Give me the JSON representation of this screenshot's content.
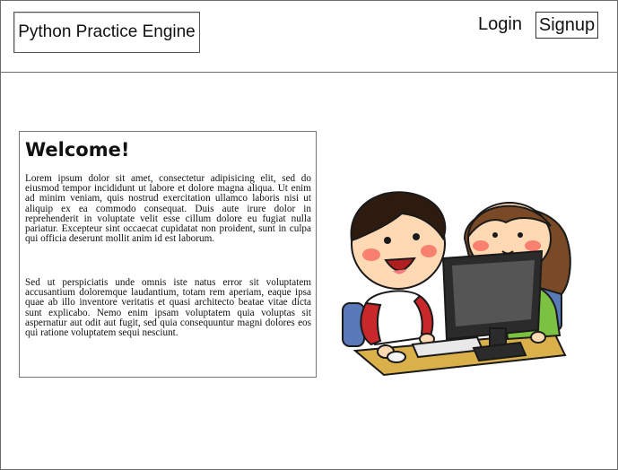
{
  "header": {
    "brand": "Python Practice Engine",
    "login_label": "Login",
    "signup_label": "Signup"
  },
  "welcome": {
    "title": "Welcome!",
    "paragraph_1": "Lorem ipsum dolor sit amet, consectetur adipisicing elit, sed do eiusmod tempor incididunt ut labore et dolore magna aliqua. Ut enim ad minim veniam, quis nostrud exercitation ullamco laboris nisi ut aliquip ex ea commodo consequat. Duis aute irure dolor in reprehenderit in voluptate velit esse cillum dolore eu fugiat nulla pariatur. Excepteur sint occaecat cupidatat non proident, sunt in culpa qui officia deserunt mollit anim id est laborum.",
    "paragraph_2": "Sed ut perspiciatis unde omnis iste natus error sit voluptatem accusantium doloremque laudantium, totam rem aperiam, eaque ipsa quae ab illo inventore veritatis et quasi architecto beatae vitae dicta sunt explicabo. Nemo enim ipsam voluptatem quia voluptas sit aspernatur aut odit aut fugit, sed quia consequuntur magni dolores eos qui ratione voluptatem sequi nesciunt."
  },
  "illustration": {
    "icon": "kids-at-computer-illustration"
  }
}
